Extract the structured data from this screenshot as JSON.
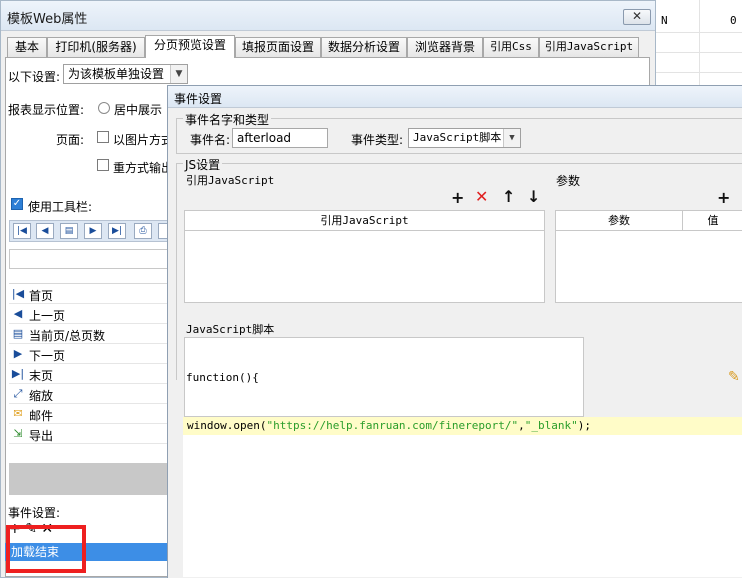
{
  "sheet": {
    "col_n": "N",
    "col_0": "0"
  },
  "main_window": {
    "title": "模板Web属性",
    "close_glyph": "✕",
    "tabs": [
      "基本",
      "打印机(服务器)",
      "分页预览设置",
      "填报页面设置",
      "数据分析设置",
      "浏览器背景",
      "引用Css",
      "引用JavaScript"
    ],
    "active_tab": "分页预览设置",
    "settings_label": "以下设置:",
    "settings_value": "为该模板单独设置",
    "report_position_label": "报表显示位置:",
    "center_label": "居中展示",
    "page_label": "页面:",
    "pic_option": "以图片方式",
    "redraw_option": "重方式输出",
    "use_toolbar_label": "使用工具栏:",
    "toolbar_items": [
      "首页",
      "上一页",
      "当前页/总页数",
      "下一页",
      "末页",
      "缩放",
      "邮件",
      "导出"
    ],
    "event_settings_label": "事件设置:",
    "event_tools": "+ ✎ ✕",
    "selected_event": "加载结束"
  },
  "event_dialog": {
    "title": "事件设置",
    "name_type_group": "事件名字和类型",
    "event_name_label": "事件名:",
    "event_name_value": "afterload",
    "event_type_label": "事件类型:",
    "event_type_value": "JavaScript脚本",
    "js_group": "JS设置",
    "ref_js_label": "引用JavaScript",
    "params_label": "参数",
    "ref_js_header": "引用JavaScript",
    "params_header": "参数",
    "params_header2": "值",
    "script_label": "JavaScript脚本",
    "function_text": "function(){",
    "code_prefix": "window.open(",
    "code_url": "\"https://help.fanruan.com/finereport/\"",
    "code_sep": ",",
    "code_target": "\"_blank\"",
    "code_suffix": ");"
  }
}
